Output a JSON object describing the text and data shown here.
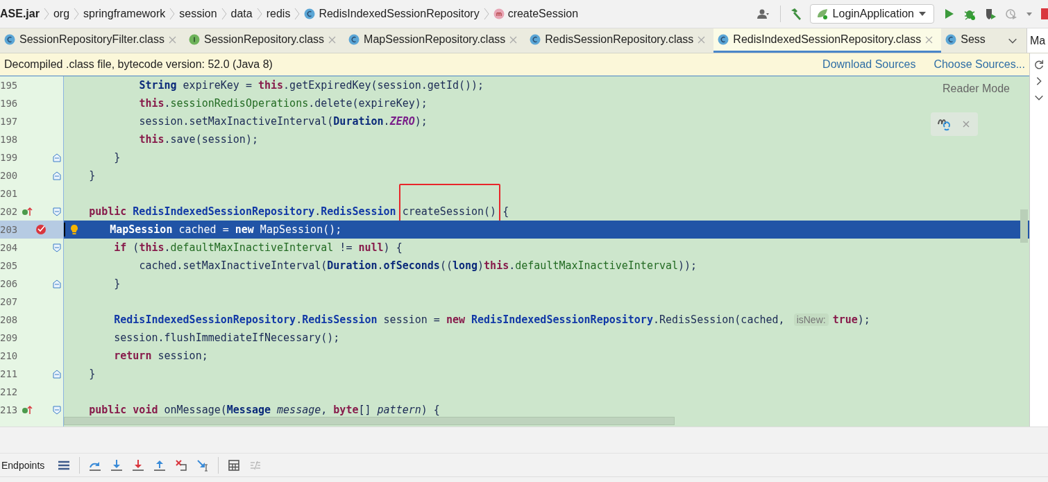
{
  "breadcrumbs": [
    {
      "text": "ASE.jar",
      "kind": "jar"
    },
    {
      "text": "org",
      "kind": "package"
    },
    {
      "text": "springframework",
      "kind": "package"
    },
    {
      "text": "session",
      "kind": "package"
    },
    {
      "text": "data",
      "kind": "package"
    },
    {
      "text": "redis",
      "kind": "package"
    },
    {
      "text": "RedisIndexedSessionRepository",
      "kind": "class"
    },
    {
      "text": "createSession",
      "kind": "method"
    }
  ],
  "run_config": {
    "label": "LoginApplication"
  },
  "tabs": [
    {
      "label": "SessionRepositoryFilter.class",
      "kind": "class",
      "selected": false,
      "closable": true
    },
    {
      "label": "SessionRepository.class",
      "kind": "interface",
      "selected": false,
      "closable": true
    },
    {
      "label": "MapSessionRepository.class",
      "kind": "class",
      "selected": false,
      "closable": true
    },
    {
      "label": "RedisSessionRepository.class",
      "kind": "class",
      "selected": false,
      "closable": true
    },
    {
      "label": "RedisIndexedSessionRepository.class",
      "kind": "class",
      "selected": true,
      "closable": true
    },
    {
      "label": "Sess",
      "kind": "class",
      "selected": false,
      "closable": false
    }
  ],
  "side_tab": {
    "label": "Ma"
  },
  "banner": {
    "text": "Decompiled .class file, bytecode version: 52.0 (Java 8)",
    "links": [
      "Download Sources",
      "Choose Sources..."
    ]
  },
  "reader_mode": {
    "label": "Reader Mode"
  },
  "editor": {
    "lines": [
      {
        "number": "195",
        "selected": false,
        "tokens": [
          {
            "kind": "type",
            "text": "            String"
          },
          {
            "kind": "plain",
            "text": " expireKey = "
          },
          {
            "kind": "kw",
            "text": "this"
          },
          {
            "kind": "plain",
            "text": ".getExpiredKey(session.getId());"
          }
        ]
      },
      {
        "number": "196",
        "selected": false,
        "tokens": [
          {
            "kind": "kw",
            "text": "            this"
          },
          {
            "kind": "plain",
            "text": "."
          },
          {
            "kind": "field",
            "text": "sessionRedisOperations"
          },
          {
            "kind": "plain",
            "text": ".delete(expireKey);"
          }
        ]
      },
      {
        "number": "197",
        "selected": false,
        "tokens": [
          {
            "kind": "plain",
            "text": "            session.setMaxInactiveInterval("
          },
          {
            "kind": "type",
            "text": "Duration"
          },
          {
            "kind": "plain",
            "text": "."
          },
          {
            "kind": "static",
            "text": "ZERO"
          },
          {
            "kind": "plain",
            "text": ");"
          }
        ]
      },
      {
        "number": "198",
        "selected": false,
        "tokens": [
          {
            "kind": "kw",
            "text": "            this"
          },
          {
            "kind": "plain",
            "text": ".save(session);"
          }
        ]
      },
      {
        "number": "199",
        "selected": false,
        "fold_end": true,
        "tokens": [
          {
            "kind": "plain",
            "text": "        }"
          }
        ]
      },
      {
        "number": "200",
        "selected": false,
        "fold_end": true,
        "tokens": [
          {
            "kind": "plain",
            "text": "    }"
          }
        ]
      },
      {
        "number": "201",
        "selected": false
      },
      {
        "number": "202",
        "selected": false,
        "override_mark": true,
        "fold_start": true,
        "tokens": [
          {
            "kind": "kw",
            "text": "    public"
          },
          {
            "kind": "cls",
            "text": " RedisIndexedSessionRepository"
          },
          {
            "kind": "plain",
            "text": "."
          },
          {
            "kind": "cls",
            "text": "RedisSession "
          },
          {
            "kind": "plain",
            "text": "createSession()",
            "boxed": true
          },
          {
            "kind": "plain",
            "text": " {"
          }
        ]
      },
      {
        "number": "203",
        "selected": true,
        "breakpoint": true,
        "bulb": true,
        "tokens": [
          {
            "kind": "type",
            "text": "        MapSession"
          },
          {
            "kind": "plain",
            "text": " cached = "
          },
          {
            "kind": "kw",
            "text": "new"
          },
          {
            "kind": "plain",
            "text": " MapSession();"
          }
        ]
      },
      {
        "number": "204",
        "selected": false,
        "fold_start": true,
        "tokens": [
          {
            "kind": "kw",
            "text": "        if"
          },
          {
            "kind": "plain",
            "text": " ("
          },
          {
            "kind": "kw",
            "text": "this"
          },
          {
            "kind": "plain",
            "text": "."
          },
          {
            "kind": "field",
            "text": "defaultMaxInactiveInterval"
          },
          {
            "kind": "plain",
            "text": " != "
          },
          {
            "kind": "kw",
            "text": "null"
          },
          {
            "kind": "plain",
            "text": ") {"
          }
        ]
      },
      {
        "number": "205",
        "selected": false,
        "tokens": [
          {
            "kind": "plain",
            "text": "            cached.setMaxInactiveInterval("
          },
          {
            "kind": "type",
            "text": "Duration"
          },
          {
            "kind": "plain",
            "text": "."
          },
          {
            "kind": "type",
            "text": "ofSeconds"
          },
          {
            "kind": "plain",
            "text": "(("
          },
          {
            "kind": "type",
            "text": "long"
          },
          {
            "kind": "plain",
            "text": ")"
          },
          {
            "kind": "kw",
            "text": "this"
          },
          {
            "kind": "plain",
            "text": "."
          },
          {
            "kind": "field",
            "text": "defaultMaxInactiveInterval"
          },
          {
            "kind": "plain",
            "text": "));"
          }
        ]
      },
      {
        "number": "206",
        "selected": false,
        "fold_end": true,
        "tokens": [
          {
            "kind": "plain",
            "text": "        }"
          }
        ]
      },
      {
        "number": "207",
        "selected": false
      },
      {
        "number": "208",
        "selected": false,
        "tokens": [
          {
            "kind": "cls",
            "text": "        RedisIndexedSessionRepository"
          },
          {
            "kind": "plain",
            "text": "."
          },
          {
            "kind": "cls",
            "text": "RedisSession"
          },
          {
            "kind": "plain",
            "text": " session = "
          },
          {
            "kind": "kw",
            "text": "new"
          },
          {
            "kind": "cls",
            "text": " RedisIndexedSessionRepository"
          },
          {
            "kind": "plain",
            "text": ".RedisSession(cached, "
          },
          {
            "kind": "hint",
            "text": "isNew:"
          },
          {
            "kind": "kw",
            "text": "true"
          },
          {
            "kind": "plain",
            "text": ");"
          }
        ]
      },
      {
        "number": "209",
        "selected": false,
        "tokens": [
          {
            "kind": "plain",
            "text": "        session.flushImmediateIfNecessary();"
          }
        ]
      },
      {
        "number": "210",
        "selected": false,
        "tokens": [
          {
            "kind": "kw",
            "text": "        return"
          },
          {
            "kind": "plain",
            "text": " session;"
          }
        ]
      },
      {
        "number": "211",
        "selected": false,
        "fold_end": true,
        "tokens": [
          {
            "kind": "plain",
            "text": "    }"
          }
        ]
      },
      {
        "number": "212",
        "selected": false
      },
      {
        "number": "213",
        "selected": false,
        "override_mark": true,
        "fold_start": true,
        "tokens": [
          {
            "kind": "kw",
            "text": "    public"
          },
          {
            "kind": "kw",
            "text": " void"
          },
          {
            "kind": "plain",
            "text": " onMessage("
          },
          {
            "kind": "type",
            "text": "Message"
          },
          {
            "kind": "param",
            "text": " message"
          },
          {
            "kind": "plain",
            "text": ", "
          },
          {
            "kind": "kw",
            "text": "byte"
          },
          {
            "kind": "plain",
            "text": "[] "
          },
          {
            "kind": "param",
            "text": "pattern"
          },
          {
            "kind": "plain",
            "text": ") {"
          }
        ]
      }
    ]
  },
  "debug_toolbar": {
    "label": "Endpoints"
  }
}
